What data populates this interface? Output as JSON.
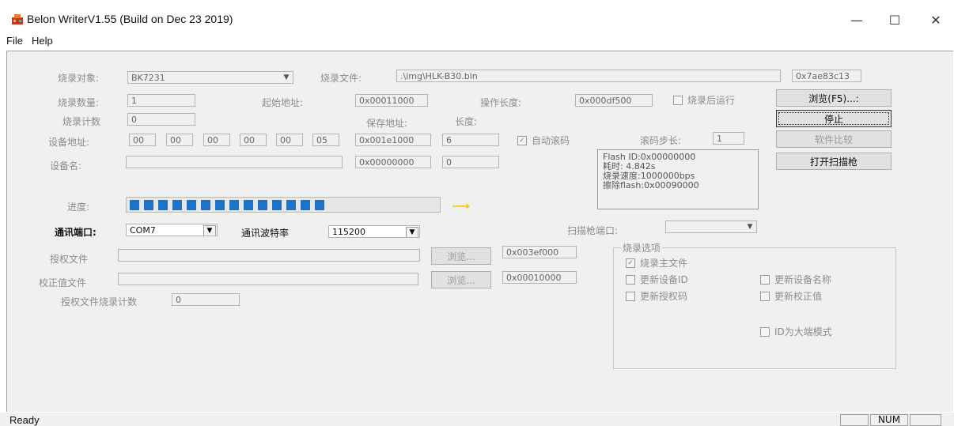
{
  "window": {
    "title": "Belon WriterV1.55 (Build on Dec 23 2019)",
    "minimize": "—",
    "maximize": "☐",
    "close": "✕"
  },
  "menu": [
    "File",
    "Help"
  ],
  "form": {
    "target_label": "烧录对象:",
    "target_value": "BK7231",
    "file_label": "烧录文件:",
    "file_value": ".\\img\\HLK-B30.bin",
    "checksum": "0x7ae83c13",
    "count_label": "烧录数量:",
    "count_value": "1",
    "start_addr_label": "起始地址:",
    "start_addr_value": "0x00011000",
    "op_len_label": "操作长度:",
    "op_len_value": "0x000df500",
    "run_after_label": "烧录后运行",
    "burn_count_label": "烧录计数",
    "burn_count_value": "0",
    "save_addr_label": "保存地址:",
    "length_label": "长度:",
    "device_addr_label": "设备地址:",
    "device_addr": [
      "00",
      "00",
      "00",
      "00",
      "00",
      "05"
    ],
    "save_addr_value": "0x001e1000",
    "length_value": "6",
    "auto_roll_label": "自动滚码",
    "roll_step_label": "滚码步长:",
    "roll_step_value": "1",
    "device_name_label": "设备名:",
    "device_name_value": "",
    "name_addr_value": "0x00000000",
    "name_len_value": "0",
    "progress_label": "进度:",
    "progress_segments": 14,
    "arrow_symbol": "⟿",
    "port_label": "通讯端口:",
    "port_value": "COM7",
    "baud_label": "通讯波特率",
    "baud_value": "115200",
    "scanner_port_label": "扫描枪端口:",
    "scanner_port_value": "",
    "auth_file_label": "授权文件",
    "auth_file_value": "",
    "auth_browse": "浏览...",
    "auth_addr": "0x003ef000",
    "calib_file_label": "校正值文件",
    "calib_file_value": "",
    "calib_browse": "浏览...",
    "calib_addr": "0x00010000",
    "auth_count_label": "授权文件烧录计数",
    "auth_count_value": "0"
  },
  "buttons": {
    "browse": "浏览(F5)...:",
    "stop": "停止",
    "compare": "软件比较",
    "scanner": "打开扫描枪"
  },
  "info": [
    "Flash ID:0x00000000",
    "耗时: 4.842s",
    "烧录速度:1000000bps",
    "擦除flash:0x00090000"
  ],
  "options": {
    "title": "烧录选项",
    "main_file": "烧录主文件",
    "update_device_id": "更新设备ID",
    "update_device_name": "更新设备名称",
    "update_auth_code": "更新授权码",
    "update_calib": "更新校正值",
    "big_endian": "ID为大端模式",
    "check_mark": "✓"
  },
  "status": {
    "text": "Ready",
    "num": "NUM"
  }
}
